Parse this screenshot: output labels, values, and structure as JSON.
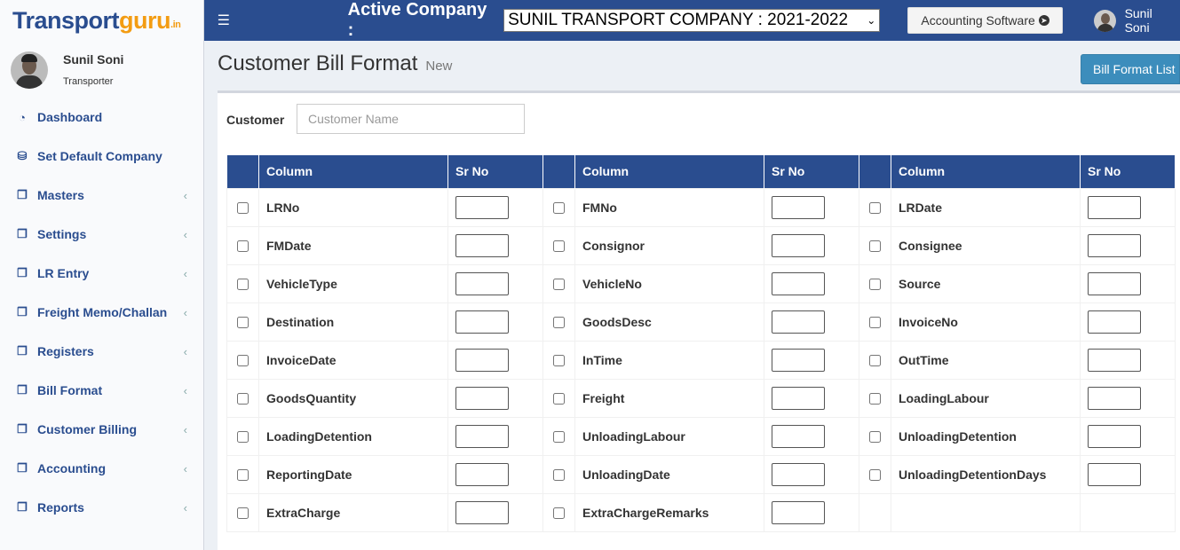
{
  "logo": {
    "part1": "Transport",
    "part2": "guru",
    "part3": ".in"
  },
  "user": {
    "name": "Sunil Soni",
    "role": "Transporter"
  },
  "menu": [
    {
      "label": "Dashboard",
      "icon": "dashboard-icon",
      "has_children": false
    },
    {
      "label": "Set Default Company",
      "icon": "database-icon",
      "has_children": false
    },
    {
      "label": "Masters",
      "icon": "copy-icon",
      "has_children": true
    },
    {
      "label": "Settings",
      "icon": "copy-icon",
      "has_children": true
    },
    {
      "label": "LR Entry",
      "icon": "copy-icon",
      "has_children": true
    },
    {
      "label": "Freight Memo/Challan",
      "icon": "copy-icon",
      "has_children": true
    },
    {
      "label": "Registers",
      "icon": "copy-icon",
      "has_children": true
    },
    {
      "label": "Bill Format",
      "icon": "copy-icon",
      "has_children": true
    },
    {
      "label": "Customer Billing",
      "icon": "copy-icon",
      "has_children": true
    },
    {
      "label": "Accounting",
      "icon": "copy-icon",
      "has_children": true
    },
    {
      "label": "Reports",
      "icon": "copy-icon",
      "has_children": true
    }
  ],
  "header": {
    "company_label": "Active Company :",
    "company_value": "SUNIL TRANSPORT COMPANY : 2021-2022",
    "accounting_button": "Accounting Software",
    "user_name": "Sunil Soni"
  },
  "page": {
    "title": "Customer Bill Format",
    "subtitle": "New",
    "bill_format_list_button": "Bill Format List"
  },
  "form": {
    "customer_label": "Customer",
    "customer_placeholder": "Customer Name",
    "customer_value": ""
  },
  "table": {
    "headers": {
      "column": "Column",
      "sr_no": "Sr No"
    },
    "rows": [
      [
        "LRNo",
        "FMNo",
        "LRDate"
      ],
      [
        "FMDate",
        "Consignor",
        "Consignee"
      ],
      [
        "VehicleType",
        "VehicleNo",
        "Source"
      ],
      [
        "Destination",
        "GoodsDesc",
        "InvoiceNo"
      ],
      [
        "InvoiceDate",
        "InTime",
        "OutTime"
      ],
      [
        "GoodsQuantity",
        "Freight",
        "LoadingLabour"
      ],
      [
        "LoadingDetention",
        "UnloadingLabour",
        "UnloadingDetention"
      ],
      [
        "ReportingDate",
        "UnloadingDate",
        "UnloadingDetentionDays"
      ],
      [
        "ExtraCharge",
        "ExtraChargeRemarks",
        ""
      ]
    ]
  },
  "colors": {
    "brand_blue": "#2a4d8f",
    "brand_orange": "#f39c12",
    "button_blue": "#3c8dbc"
  }
}
